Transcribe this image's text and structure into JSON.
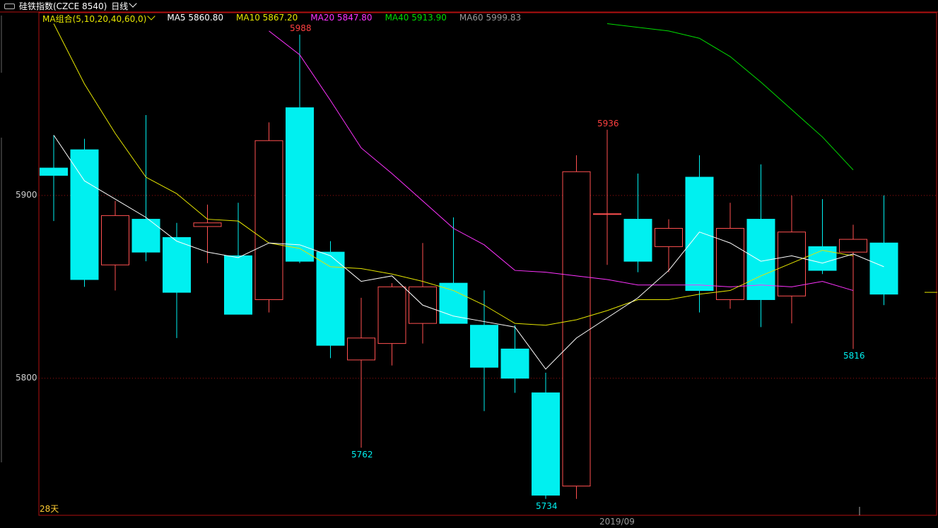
{
  "header": {
    "instrument_label": "硅铁指数(CZCE 8540)",
    "period_label": "日线"
  },
  "legend": {
    "group_label": "MA组合(5,10,20,40,60,0)",
    "items": [
      {
        "text": "MA5 5860.80",
        "color": "#ffffff"
      },
      {
        "text": "MA10 5867.20",
        "color": "#e6e600"
      },
      {
        "text": "MA20 5847.80",
        "color": "#ff33ff"
      },
      {
        "text": "MA40 5913.90",
        "color": "#00dd00"
      },
      {
        "text": "MA60 5999.83",
        "color": "#9a9a9a"
      }
    ]
  },
  "footer": {
    "days_label": "28天",
    "date_label": "2019/09"
  },
  "chart_data": {
    "type": "candlestick",
    "ylim": [
      5725,
      6000
    ],
    "yticks": [
      5800,
      5900
    ],
    "colors": {
      "up": "#ff5050",
      "down": "#00f0f0",
      "ma5": "#ffffff",
      "ma10": "#e6e600",
      "ma20": "#ff33ff",
      "ma40": "#00dd00"
    },
    "candles": [
      {
        "o": 5915,
        "h": 5933,
        "l": 5886,
        "c": 5911
      },
      {
        "o": 5925,
        "h": 5931,
        "l": 5850,
        "c": 5854
      },
      {
        "o": 5862,
        "h": 5897,
        "l": 5848,
        "c": 5889
      },
      {
        "o": 5887,
        "h": 5944,
        "l": 5864,
        "c": 5869
      },
      {
        "o": 5877,
        "h": 5885,
        "l": 5822,
        "c": 5847
      },
      {
        "o": 5883,
        "h": 5895,
        "l": 5863,
        "c": 5885
      },
      {
        "o": 5867,
        "h": 5896,
        "l": 5835,
        "c": 5835
      },
      {
        "o": 5843,
        "h": 5940,
        "l": 5836,
        "c": 5930
      },
      {
        "o": 5948,
        "h": 5988,
        "l": 5863,
        "c": 5864
      },
      {
        "o": 5869,
        "h": 5875,
        "l": 5811,
        "c": 5818
      },
      {
        "o": 5810,
        "h": 5844,
        "l": 5762,
        "c": 5822
      },
      {
        "o": 5819,
        "h": 5852,
        "l": 5807,
        "c": 5850
      },
      {
        "o": 5830,
        "h": 5874,
        "l": 5819,
        "c": 5850
      },
      {
        "o": 5852,
        "h": 5888,
        "l": 5830,
        "c": 5830
      },
      {
        "o": 5829,
        "h": 5848,
        "l": 5782,
        "c": 5806
      },
      {
        "o": 5816,
        "h": 5829,
        "l": 5792,
        "c": 5800
      },
      {
        "o": 5792,
        "h": 5803,
        "l": 5734,
        "c": 5736
      },
      {
        "o": 5741,
        "h": 5922,
        "l": 5734,
        "c": 5913
      },
      {
        "o": 5890,
        "h": 5936,
        "l": 5862,
        "c": 5890
      },
      {
        "o": 5887,
        "h": 5912,
        "l": 5858,
        "c": 5864
      },
      {
        "o": 5872,
        "h": 5887,
        "l": 5858,
        "c": 5882
      },
      {
        "o": 5910,
        "h": 5922,
        "l": 5836,
        "c": 5848
      },
      {
        "o": 5843,
        "h": 5896,
        "l": 5838,
        "c": 5882
      },
      {
        "o": 5887,
        "h": 5917,
        "l": 5828,
        "c": 5843
      },
      {
        "o": 5845,
        "h": 5900,
        "l": 5830,
        "c": 5880
      },
      {
        "o": 5872,
        "h": 5898,
        "l": 5857,
        "c": 5859
      },
      {
        "o": 5869,
        "h": 5884,
        "l": 5816,
        "c": 5876
      },
      {
        "o": 5874,
        "h": 5900,
        "l": 5840,
        "c": 5846
      }
    ],
    "ma5": [
      5933,
      5908,
      5898,
      5888,
      5875,
      5869,
      5866,
      5874,
      5873,
      5867,
      5853,
      5856,
      5840,
      5834,
      5831,
      5828,
      5805,
      5822,
      5833,
      5844,
      5859,
      5880,
      5874,
      5864,
      5867,
      5863,
      5868,
      5861
    ],
    "ma10": [
      5994,
      5961,
      5934,
      5910,
      5901,
      5887,
      5886,
      5874,
      5871,
      5861,
      5860,
      5857,
      5853,
      5848,
      5840,
      5830,
      5829,
      5832,
      5837,
      5843,
      5843,
      5846,
      5848,
      5856,
      5863,
      5870,
      5867,
      null
    ],
    "ma20": [
      null,
      null,
      null,
      null,
      null,
      null,
      null,
      5990,
      5977,
      5952,
      5926,
      5912,
      5897,
      5882,
      5873,
      5859,
      5858,
      5856,
      5854,
      5851,
      5851,
      5851,
      5850,
      5851,
      5850,
      5853,
      5848,
      null
    ],
    "ma40": [
      null,
      null,
      null,
      null,
      null,
      null,
      null,
      null,
      null,
      null,
      null,
      null,
      null,
      null,
      null,
      null,
      null,
      null,
      5994,
      5992,
      5990,
      5986,
      5976,
      5962,
      5947,
      5932,
      5914,
      null
    ]
  },
  "annotations": [
    {
      "text": "5988",
      "color": "#ff4040"
    },
    {
      "text": "5762",
      "color": "#00f0f0"
    },
    {
      "text": "5734",
      "color": "#00f0f0"
    },
    {
      "text": "5936",
      "color": "#ff4040"
    },
    {
      "text": "5816",
      "color": "#00f0f0"
    }
  ]
}
